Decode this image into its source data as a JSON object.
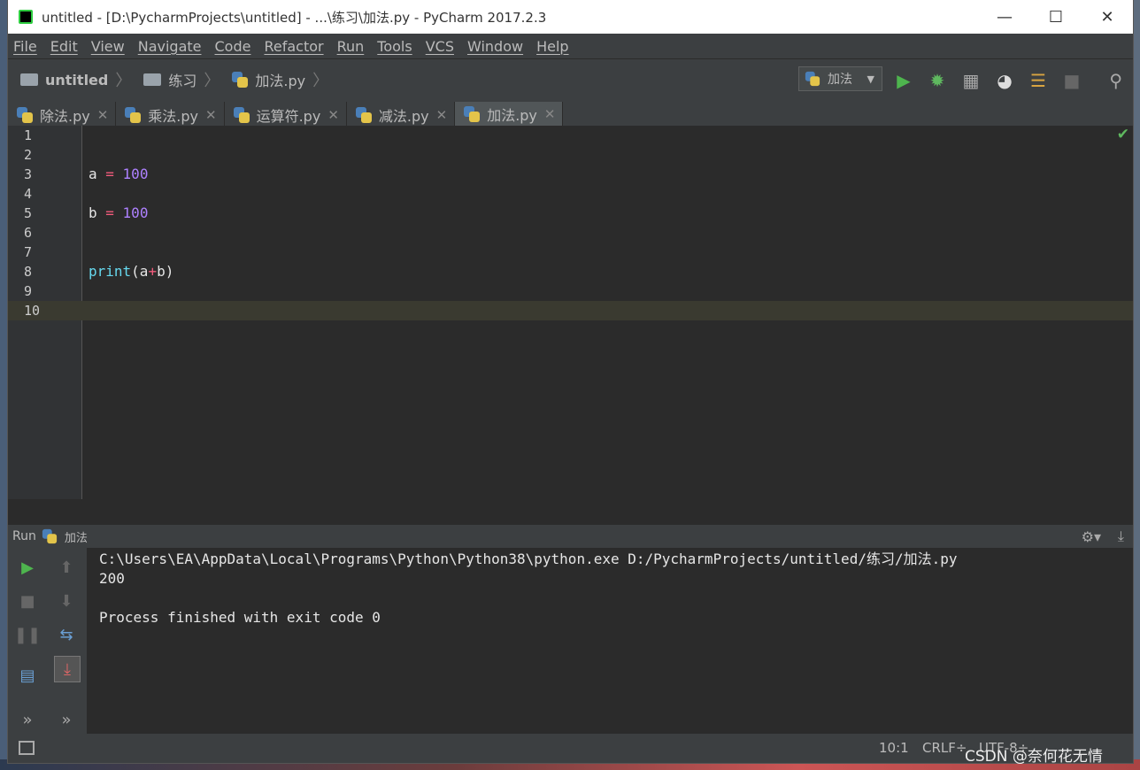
{
  "window": {
    "title": "untitled - [D:\\PycharmProjects\\untitled] - ...\\练习\\加法.py - PyCharm 2017.2.3",
    "controls": {
      "minimize": "—",
      "maximize": "☐",
      "close": "✕"
    }
  },
  "menu": [
    "File",
    "Edit",
    "View",
    "Navigate",
    "Code",
    "Refactor",
    "Run",
    "Tools",
    "VCS",
    "Window",
    "Help"
  ],
  "breadcrumb": {
    "project": "untitled",
    "folder": "练习",
    "file": "加法.py"
  },
  "run_config": {
    "name": "加法"
  },
  "tabs": [
    {
      "label": "除法.py",
      "close": "✕"
    },
    {
      "label": "乘法.py",
      "close": "✕"
    },
    {
      "label": "运算符.py",
      "close": "✕"
    },
    {
      "label": "减法.py",
      "close": "✕"
    },
    {
      "label": "加法.py",
      "close": "✕",
      "active": true
    }
  ],
  "editor": {
    "lines": [
      {
        "n": "1",
        "code": ""
      },
      {
        "n": "2",
        "code": ""
      },
      {
        "n": "3",
        "code": "a = 100"
      },
      {
        "n": "4",
        "code": ""
      },
      {
        "n": "5",
        "code": "b = 100"
      },
      {
        "n": "6",
        "code": ""
      },
      {
        "n": "7",
        "code": ""
      },
      {
        "n": "8",
        "code": "print(a+b)"
      },
      {
        "n": "9",
        "code": ""
      },
      {
        "n": "10",
        "code": ""
      }
    ],
    "current_line": "10"
  },
  "run_panel": {
    "label": "Run",
    "config": "加法",
    "console": [
      "C:\\Users\\EA\\AppData\\Local\\Programs\\Python\\Python38\\python.exe D:/PycharmProjects/untitled/练习/加法.py",
      "200",
      "",
      "Process finished with exit code 0"
    ]
  },
  "status": {
    "position": "10:1",
    "line_sep": "CRLF÷",
    "encoding": "UTF-8÷"
  },
  "watermark": "CSDN @奈何花无情",
  "colors": {
    "editor_bg": "#2b2b2b",
    "operator": "#f25b7c",
    "number": "#ae81ff",
    "builtin": "#66d9ef",
    "run_green": "#4eb54e"
  }
}
